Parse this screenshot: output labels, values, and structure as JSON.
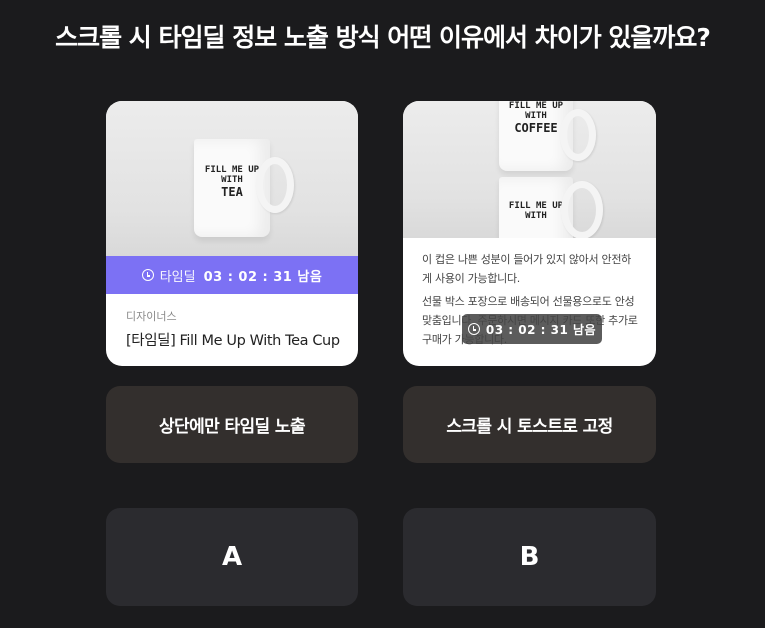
{
  "question": "스크롤 시 타임딜 정보 노출 방식 어떤 이유에서 차이가 있을까요?",
  "card_a": {
    "mug_text": [
      "FILL ME UP",
      "WITH",
      "TEA"
    ],
    "deal_label": "타임딜",
    "deal_time": "03 : 02 : 31 남음",
    "seller": "디자이너스",
    "product_name": "[타임딜] Fill Me Up With Tea Cup",
    "option_label": "상단에만 타임딜 노출"
  },
  "card_b": {
    "mug_top_text": [
      "FILL ME UP",
      "WITH",
      "COFFEE"
    ],
    "mug_bottom_text": [
      "FILL ME UP",
      "WITH"
    ],
    "description_1": "이 컵은 나쁜 성분이 들어가 있지 않아서 안전하게 사용이 가능합니다.",
    "description_2": "선물 박스 포장으로 배송되어 선물용으로도 안성맞춤입니다. 주문하시면 메시지 카드 또한 추가로 구매가 가능합니다.",
    "toast_time": "03 : 02 : 31 남음",
    "option_label": "스크롤 시 토스트로 고정"
  },
  "choices": {
    "a": "A",
    "b": "B"
  },
  "colors": {
    "background": "#1b1b1d",
    "deal_bar": "#7c71f4",
    "label_bg": "#332f2d",
    "choice_bg": "#2b2b2f"
  }
}
